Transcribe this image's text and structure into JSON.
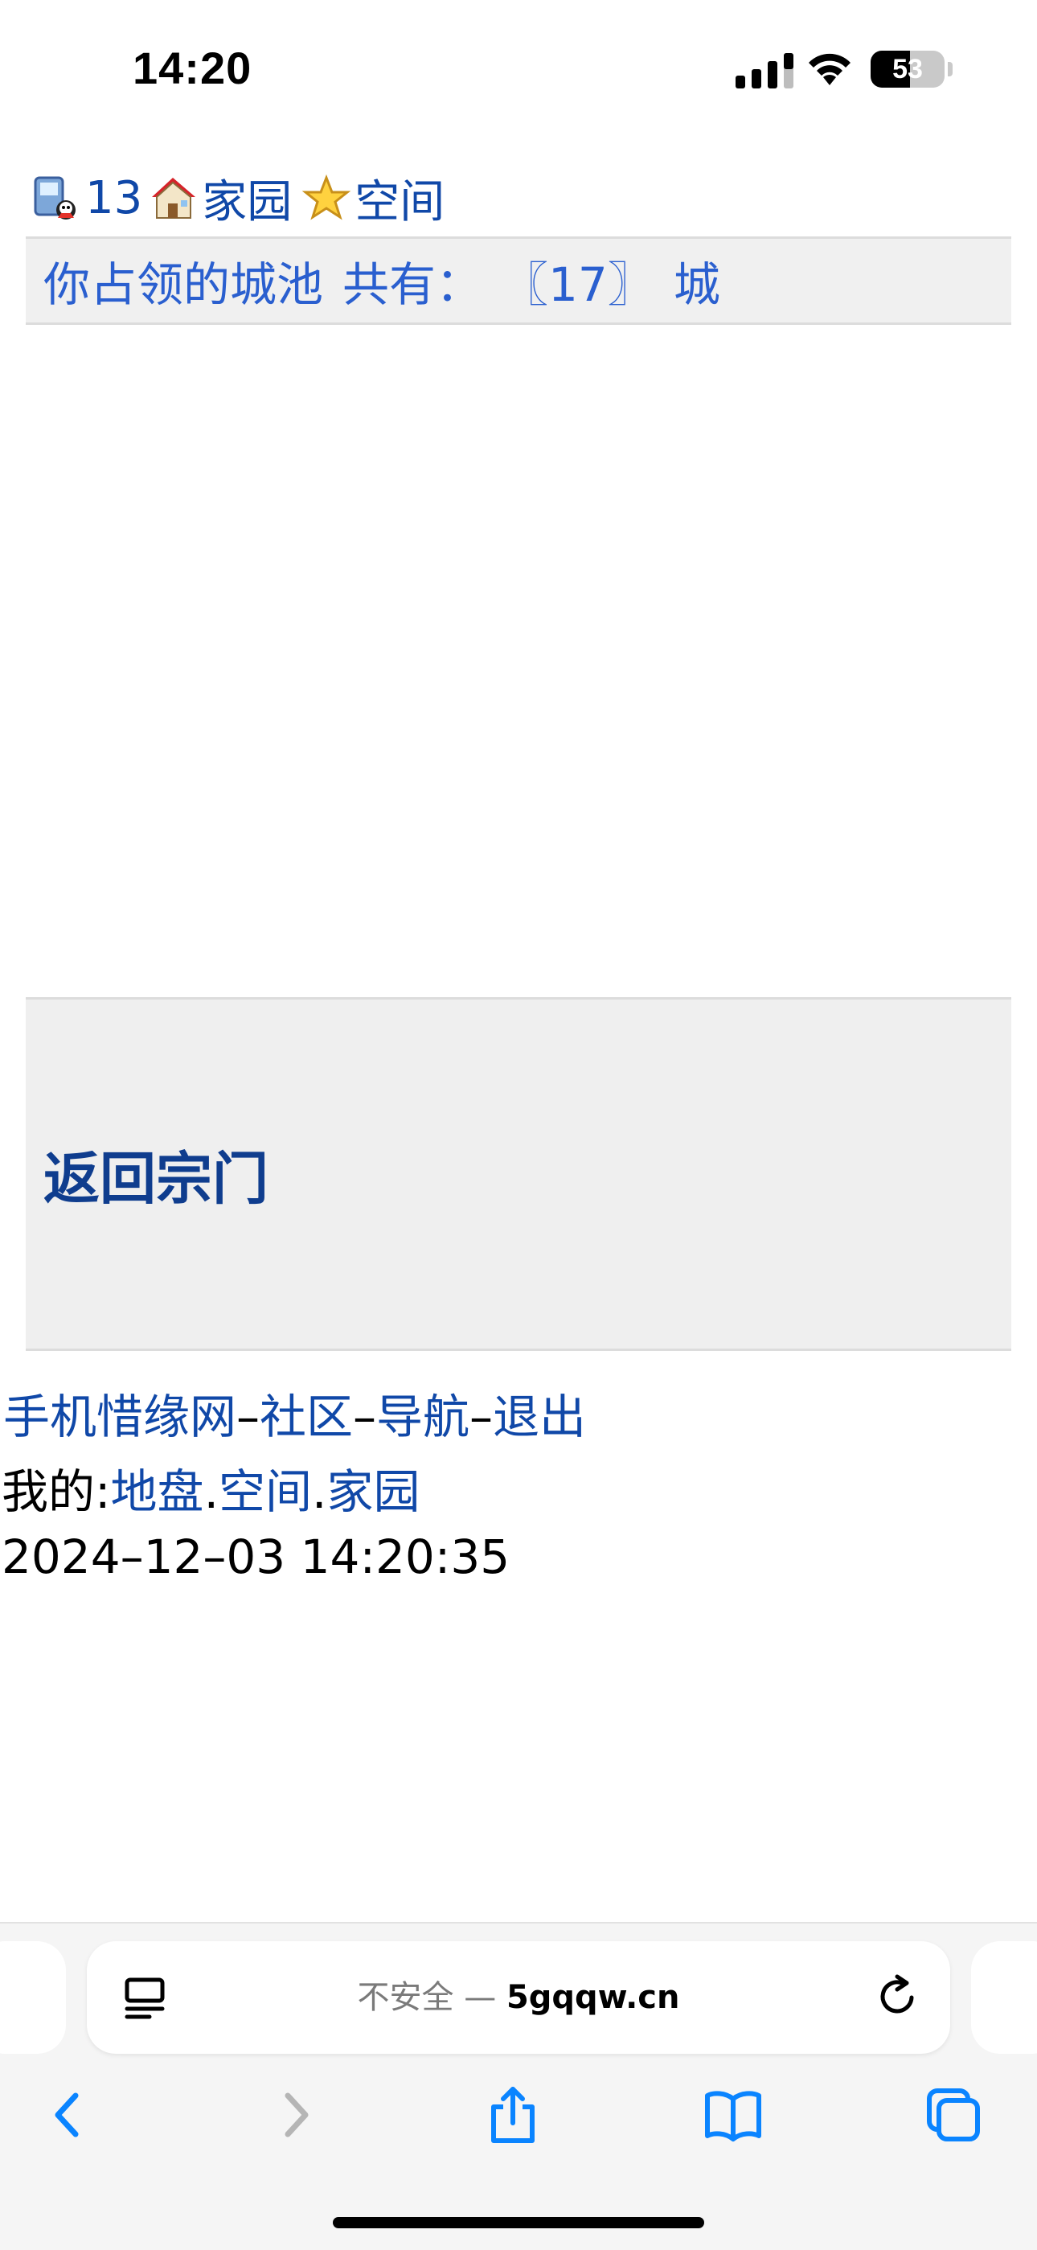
{
  "status": {
    "time": "14:20",
    "battery": "53",
    "battery_level_percent": 53,
    "icons": [
      "cellular-signal-icon",
      "wifi-icon",
      "battery-icon"
    ]
  },
  "top_links": {
    "count": "13",
    "home": "家园",
    "space": "空间",
    "icons": [
      "qq-user-icon",
      "house-icon",
      "star-icon"
    ]
  },
  "title_bar": {
    "text_prefix": "你占领的城池",
    "text_total_label": "共有：",
    "text_count": "〖17〗",
    "text_suffix": "城"
  },
  "back_box": {
    "label": "返回宗门"
  },
  "footer_nav": {
    "items": [
      "手机惜缘网",
      "社区",
      "导航",
      "退出"
    ],
    "separator": "–"
  },
  "my_line": {
    "prefix": "我的:",
    "links": [
      "地盘",
      "空间",
      "家园"
    ],
    "separator": "."
  },
  "timestamp": "2024–12–03 14:20:35",
  "browser": {
    "security_label": "不安全 — ",
    "domain": "5gqqw.cn",
    "toolbar_icons": [
      "back-icon",
      "forward-icon",
      "share-icon",
      "bookmarks-icon",
      "tabs-icon",
      "reader-mode-icon",
      "reload-icon"
    ]
  },
  "colors": {
    "link": "#1048a8",
    "title_bar_text": "#2a5fcf",
    "back_link": "#0f3d8e",
    "panel_bg": "#f0f0f0",
    "safari_blue": "#0a84ff"
  }
}
